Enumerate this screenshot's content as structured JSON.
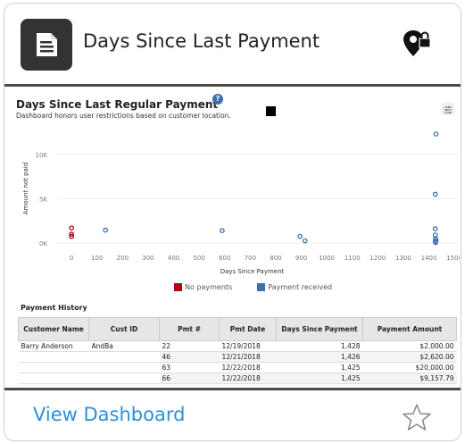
{
  "header": {
    "title": "Days Since Last Payment"
  },
  "viz": {
    "title": "Days Since Last Regular Payment",
    "subtitle": "Dashboard honors user restrictions based on customer location.",
    "help_symbol": "?",
    "ylabel": "Amount not paid",
    "xlabel": "Days Since Payment",
    "yticks": [
      "10K",
      "5K",
      "0K"
    ],
    "xticks": [
      "0",
      "100",
      "200",
      "300",
      "400",
      "500",
      "600",
      "700",
      "800",
      "900",
      "1000",
      "1100",
      "1200",
      "1300",
      "1400",
      "1500"
    ]
  },
  "chart_data": {
    "type": "scatter",
    "xlabel": "Days Since Payment",
    "ylabel": "Amount not paid",
    "xlim": [
      -60,
      1510
    ],
    "ylim": [
      -500,
      12800
    ],
    "series": [
      {
        "name": "No payments",
        "color": "#b00020",
        "points": [
          [
            0,
            1700
          ],
          [
            0,
            1000
          ],
          [
            0,
            750
          ]
        ]
      },
      {
        "name": "Payment received",
        "color": "#3e6fb0",
        "points": [
          [
            133,
            1450
          ],
          [
            590,
            1400
          ],
          [
            895,
            750
          ],
          [
            915,
            250
          ],
          [
            1428,
            12300
          ],
          [
            1425,
            5500
          ],
          [
            1425,
            1600
          ],
          [
            1425,
            900
          ],
          [
            1426,
            500
          ],
          [
            1428,
            300
          ],
          [
            1425,
            150
          ],
          [
            1426,
            50
          ]
        ]
      }
    ]
  },
  "legend": [
    {
      "label": "No payments",
      "color": "#b00020"
    },
    {
      "label": "Payment received",
      "color": "#3e6fb0"
    }
  ],
  "history": {
    "title": "Payment History",
    "columns": [
      "Customer Name",
      "Cust ID",
      "Pmt #",
      "Pmt Date",
      "Days Since Payment",
      "Payment Amount"
    ],
    "rows": [
      {
        "name": "Barry Anderson",
        "cust_id": "AndBa",
        "pmt": "22",
        "date": "12/19/2018",
        "days": "1,428",
        "amount": "$2,000.00"
      },
      {
        "name": "",
        "cust_id": "",
        "pmt": "46",
        "date": "12/21/2018",
        "days": "1,426",
        "amount": "$2,620.00"
      },
      {
        "name": "",
        "cust_id": "",
        "pmt": "63",
        "date": "12/22/2018",
        "days": "1,425",
        "amount": "$20,000.00"
      },
      {
        "name": "",
        "cust_id": "",
        "pmt": "66",
        "date": "12/22/2018",
        "days": "1,425",
        "amount": "$9,157.79"
      }
    ]
  },
  "footer": {
    "view_label": "View Dashboard"
  },
  "icons": {
    "app": "document-icon",
    "lock_pin": "location-lock-icon",
    "favorite": "star-icon",
    "filter": "filter-sliders-icon"
  }
}
